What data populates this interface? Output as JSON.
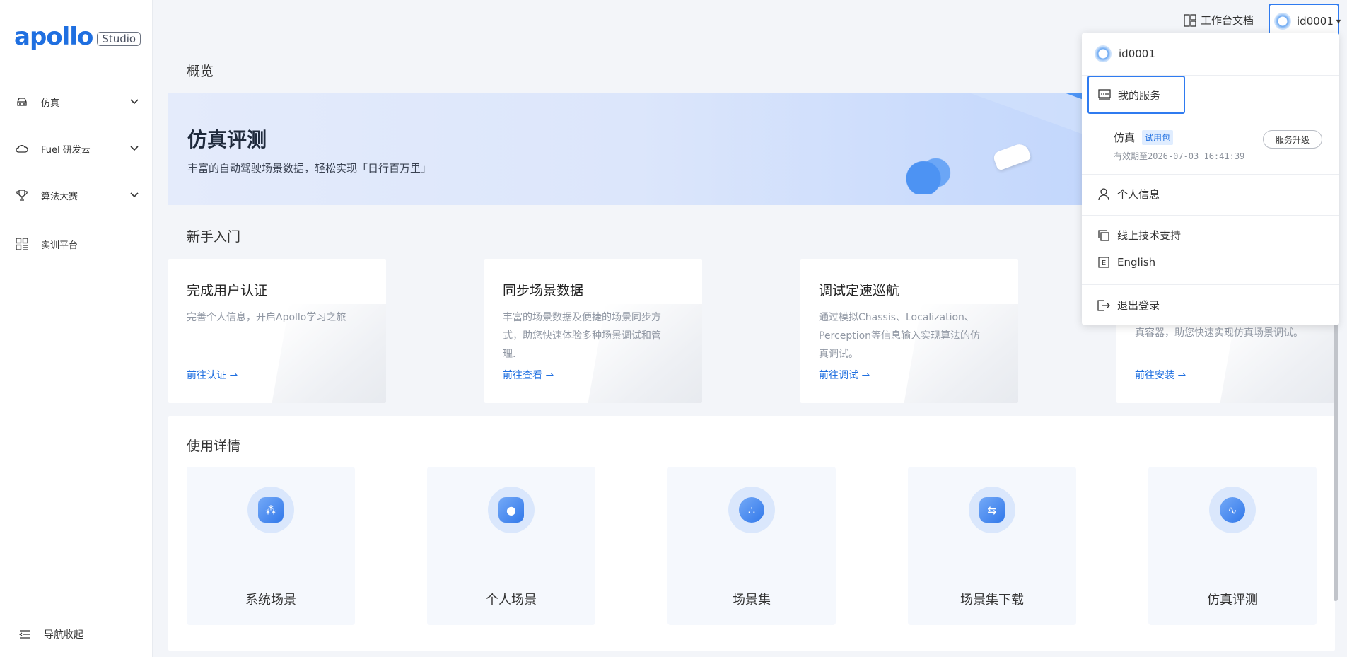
{
  "logo": {
    "word": "apollo",
    "badge": "Studio"
  },
  "sidebar": {
    "items": [
      {
        "label": "仿真"
      },
      {
        "label": "Fuel 研发云"
      },
      {
        "label": "算法大赛"
      },
      {
        "label": "实训平台"
      }
    ],
    "collapse_label": "导航收起"
  },
  "topbar": {
    "docs_label": "工作台文档",
    "username": "id0001"
  },
  "overview": {
    "title": "概览",
    "banner_title": "仿真评测",
    "banner_subtitle": "丰富的自动驾驶场景数据，轻松实现「日行百万里」"
  },
  "getting_started": {
    "title": "新手入门",
    "cards": [
      {
        "title": "完成用户认证",
        "desc": "完善个人信息，开启Apollo学习之旅",
        "link": "前往认证 ⇀"
      },
      {
        "title": "同步场景数据",
        "desc": "丰富的场景数据及便捷的场景同步方式，助您快速体验多种场景调试和管理.",
        "link": "前往查看 ⇀"
      },
      {
        "title": "调试定速巡航",
        "desc": "通过模拟Chassis、Localization、Perception等信息输入实现算法的仿真调试。",
        "link": "前往调试 ⇀"
      },
      {
        "title": "",
        "desc": "真容器，助您快速实现仿真场景调试。",
        "link": "前往安装 ⇀"
      }
    ]
  },
  "usage": {
    "title": "使用详情",
    "items": [
      {
        "label": "系统场景"
      },
      {
        "label": "个人场景"
      },
      {
        "label": "场景集"
      },
      {
        "label": "场景集下载"
      },
      {
        "label": "仿真评测"
      }
    ]
  },
  "dropdown": {
    "username": "id0001",
    "my_service": "我的服务",
    "service_name": "仿真",
    "service_badge": "试用包",
    "valid_until": "有效期至2026-07-03 16:41:39",
    "upgrade": "服务升级",
    "profile": "个人信息",
    "support": "线上技术支持",
    "language": "English",
    "logout": "退出登录"
  }
}
